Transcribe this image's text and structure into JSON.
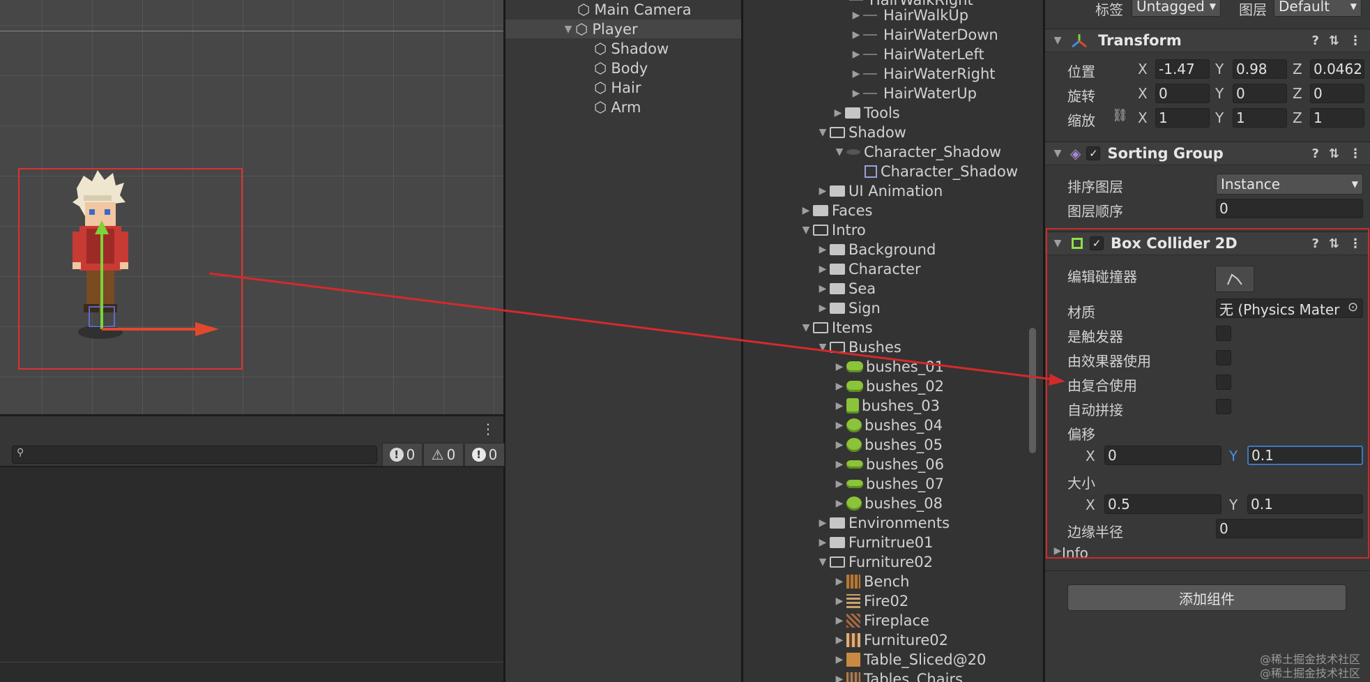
{
  "console": {
    "counts": [
      "0",
      "0",
      "0"
    ]
  },
  "hierarchy": {
    "items": [
      "Main Camera",
      "Player",
      "Shadow",
      "Body",
      "Hair",
      "Arm"
    ]
  },
  "project": {
    "rows": [
      "HairWalkRight",
      "HairWalkUp",
      "HairWaterDown",
      "HairWaterLeft",
      "HairWaterRight",
      "HairWaterUp",
      "Tools",
      "Shadow",
      "Character_Shadow",
      "Character_Shadow",
      "UI Animation",
      "Faces",
      "Intro",
      "Background",
      "Character",
      "Sea",
      "Sign",
      "Items",
      "Bushes",
      "bushes_01",
      "bushes_02",
      "bushes_03",
      "bushes_04",
      "bushes_05",
      "bushes_06",
      "bushes_07",
      "bushes_08",
      "Environments",
      "Furnitrue01",
      "Furniture02",
      "Bench",
      "Fire02",
      "Fireplace",
      "Furniture02",
      "Table_Sliced@20",
      "Tables_Chairs"
    ]
  },
  "inspector": {
    "tag_label": "标签",
    "tag_value": "Untagged",
    "layer_label": "图层",
    "layer_value": "Default",
    "transform": {
      "title": "Transform",
      "position_label": "位置",
      "rotation_label": "旋转",
      "scale_label": "缩放",
      "axes": [
        "X",
        "Y",
        "Z"
      ],
      "position": [
        "-1.47",
        "0.98",
        "0.0462"
      ],
      "rotation": [
        "0",
        "0",
        "0"
      ],
      "scale": [
        "1",
        "1",
        "1"
      ]
    },
    "sorting_group": {
      "title": "Sorting Group",
      "sorting_layer_label": "排序图层",
      "sorting_layer_value": "Instance",
      "order_label": "图层顺序",
      "order_value": "0"
    },
    "box_collider": {
      "title": "Box Collider 2D",
      "edit_label": "编辑碰撞器",
      "material_label": "材质",
      "material_value": "无 (Physics Mater",
      "is_trigger_label": "是触发器",
      "used_by_effector_label": "由效果器使用",
      "used_by_composite_label": "由复合使用",
      "auto_tiling_label": "自动拼接",
      "offset_label": "偏移",
      "offset_x": "0",
      "offset_y": "0.1",
      "size_label": "大小",
      "size_x": "0.5",
      "size_y": "0.1",
      "edge_radius_label": "边缘半径",
      "edge_radius_value": "0",
      "info_label": "Info"
    },
    "add_component_label": "添加组件"
  },
  "watermark": [
    "@稀土掘金技术社区",
    "@稀土掘金技术社区"
  ]
}
